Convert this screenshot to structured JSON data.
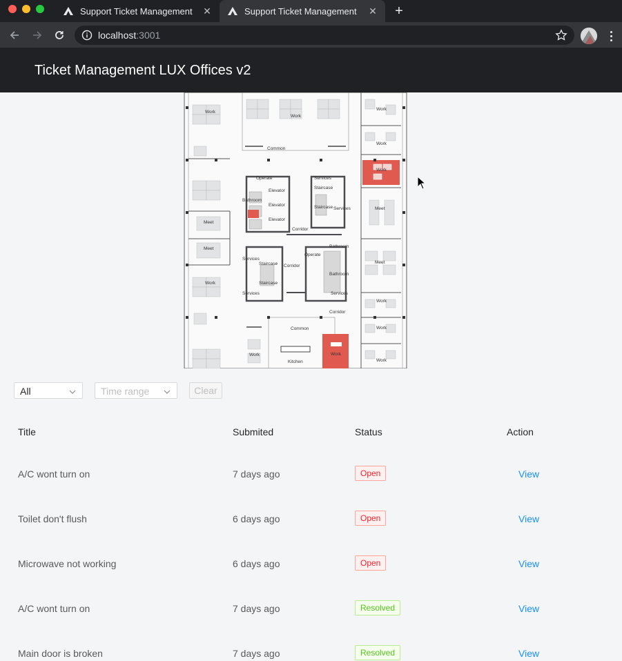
{
  "browser": {
    "tabs": [
      {
        "title": "Support Ticket Management"
      },
      {
        "title": "Support Ticket Management"
      }
    ],
    "url_host": "localhost",
    "url_port": ":3001"
  },
  "app": {
    "title": "Ticket Management LUX Offices v2"
  },
  "floorplan": {
    "labels": {
      "work": "Work",
      "common": "Common",
      "elevator": "Elevator",
      "operate": "Operate",
      "services": "Services",
      "bathroom": "Bathroom",
      "staircase": "Staircase",
      "corridor": "Corridor",
      "meet": "Meet",
      "kitchen": "Kitchen"
    },
    "highlight_color": "#e05a4f"
  },
  "filters": {
    "status_value": "All",
    "time_placeholder": "Time range",
    "clear_label": "Clear"
  },
  "table": {
    "columns": {
      "title": "Title",
      "submitted": "Submited",
      "status": "Status",
      "action": "Action"
    },
    "rows": [
      {
        "title": "A/C wont turn on",
        "submitted": "7 days ago",
        "status": "Open",
        "action": "View"
      },
      {
        "title": "Toilet don't flush",
        "submitted": "6 days ago",
        "status": "Open",
        "action": "View"
      },
      {
        "title": "Microwave not working",
        "submitted": "6 days ago",
        "status": "Open",
        "action": "View"
      },
      {
        "title": "A/C wont turn on",
        "submitted": "7 days ago",
        "status": "Resolved",
        "action": "View"
      },
      {
        "title": "Main door is broken",
        "submitted": "7 days ago",
        "status": "Resolved",
        "action": "View"
      }
    ]
  }
}
